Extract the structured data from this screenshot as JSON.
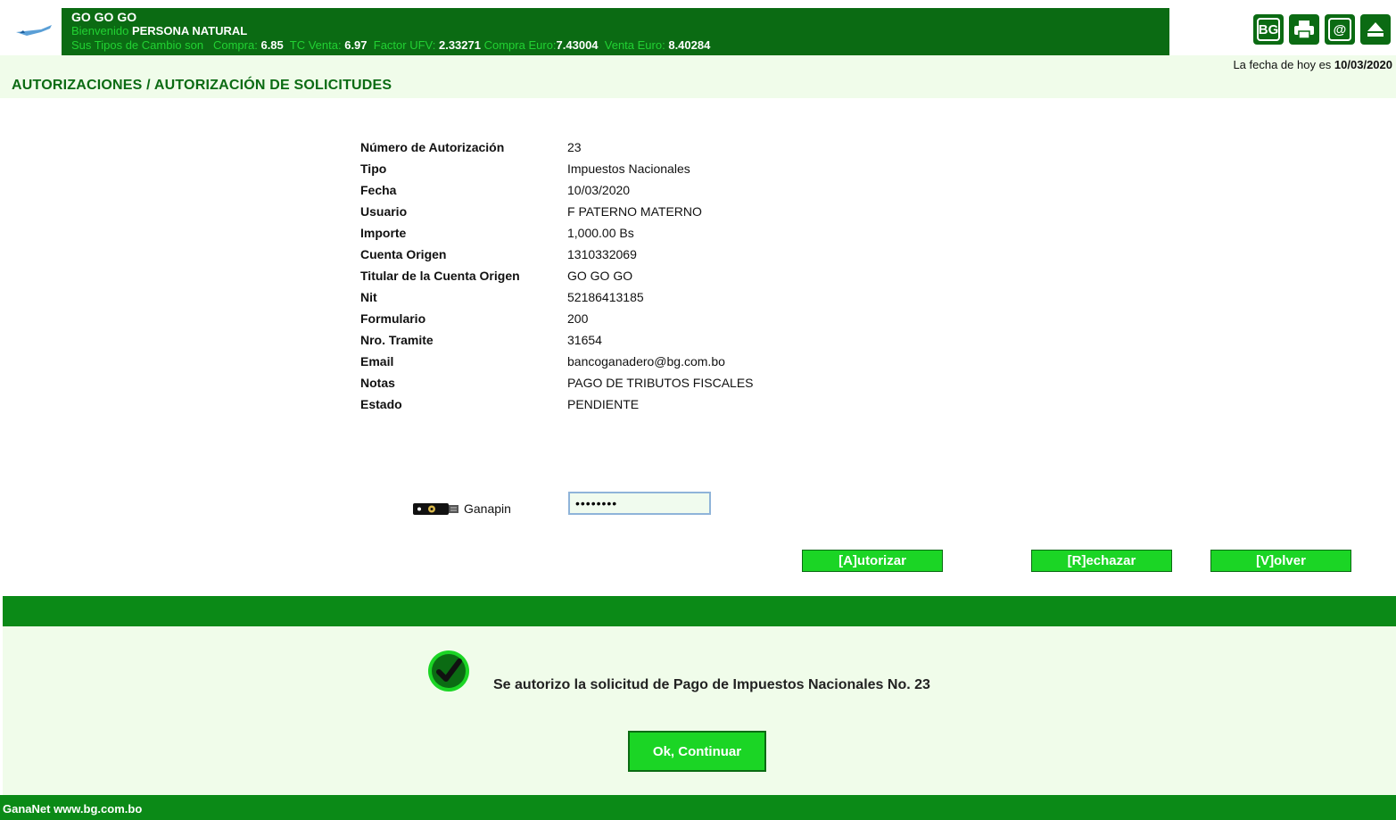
{
  "header": {
    "company": "GO GO GO",
    "welcome_label": "Bienvenido",
    "user_type": "PERSONA NATURAL",
    "rates_label": "Sus Tipos de Cambio son",
    "compra_label": "Compra:",
    "compra_value": "6.85",
    "tc_venta_label": "TC Venta:",
    "tc_venta_value": "6.97",
    "ufv_label": "Factor UFV:",
    "ufv_value": "2.33271",
    "compra_euro_label": "Compra Euro:",
    "compra_euro_value": "7.43004",
    "venta_euro_label": "Venta Euro:",
    "venta_euro_value": "8.40284"
  },
  "toolbar": {
    "bg_label": "BG",
    "icons": [
      "print-icon",
      "email-icon",
      "eject-icon"
    ]
  },
  "date": {
    "label": "La fecha de hoy es",
    "value": "10/03/2020"
  },
  "breadcrumb": "AUTORIZACIONES / AUTORIZACIÓN DE SOLICITUDES",
  "details": [
    {
      "label": "Número de Autorización",
      "value": "23"
    },
    {
      "label": "Tipo",
      "value": "Impuestos Nacionales"
    },
    {
      "label": "Fecha",
      "value": "10/03/2020"
    },
    {
      "label": "Usuario",
      "value": "F PATERNO MATERNO"
    },
    {
      "label": "Importe",
      "value": "1,000.00 Bs"
    },
    {
      "label": "Cuenta Origen",
      "value": "1310332069"
    },
    {
      "label": "Titular de la Cuenta Origen",
      "value": "GO GO GO"
    },
    {
      "label": "Nit",
      "value": "52186413185"
    },
    {
      "label": "Formulario",
      "value": "200"
    },
    {
      "label": "Nro. Tramite",
      "value": "31654"
    },
    {
      "label": "Email",
      "value": "bancoganadero@bg.com.bo"
    },
    {
      "label": "Notas",
      "value": "PAGO DE TRIBUTOS FISCALES"
    },
    {
      "label": "Estado",
      "value": "PENDIENTE"
    }
  ],
  "pin": {
    "label": "Ganapin",
    "value": "••••••••"
  },
  "actions": {
    "authorize": "[A]utorizar",
    "reject": "[R]echazar",
    "back": "[V]olver"
  },
  "result": {
    "message": "Se autorizo la solicitud de Pago de Impuestos Nacionales No. 23",
    "ok_button": "Ok, Continuar"
  },
  "footer": {
    "text": "GanaNet www.bg.com.bo"
  },
  "colors": {
    "brand_dark_green": "#0b6b13",
    "brand_green": "#0b8a17",
    "button_green": "#1bd525",
    "highlight_text": "#22d133",
    "panel_bg": "#f0fcea"
  }
}
